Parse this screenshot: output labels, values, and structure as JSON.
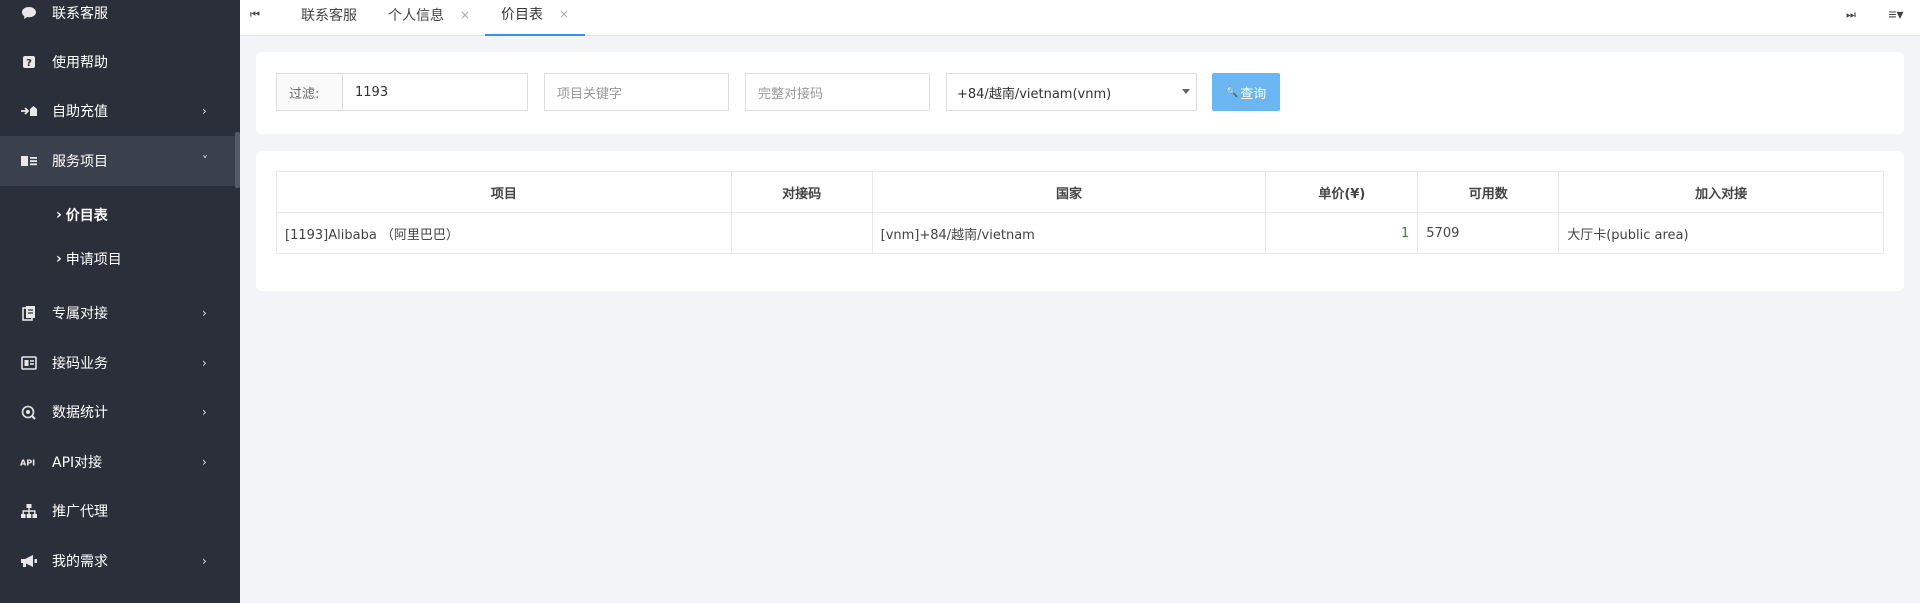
{
  "sidebar": {
    "items": [
      {
        "label": "联系客服",
        "icon": "chat-icon",
        "arrow": ""
      },
      {
        "label": "使用帮助",
        "icon": "help-icon",
        "arrow": ""
      },
      {
        "label": "自助充值",
        "icon": "recharge-icon",
        "arrow": "›"
      },
      {
        "label": "服务项目",
        "icon": "service-icon",
        "arrow": "˅"
      },
      {
        "label": "专属对接",
        "icon": "docs-icon",
        "arrow": "›"
      },
      {
        "label": "接码业务",
        "icon": "sim-icon",
        "arrow": "›"
      },
      {
        "label": "数据统计",
        "icon": "stats-icon",
        "arrow": "›"
      },
      {
        "label": "API对接",
        "icon": "api-icon",
        "arrow": "›"
      },
      {
        "label": "推广代理",
        "icon": "sitemap-icon",
        "arrow": ""
      },
      {
        "label": "我的需求",
        "icon": "megaphone-icon",
        "arrow": "›"
      }
    ],
    "subitems": [
      {
        "label": "价目表",
        "caret": "›"
      },
      {
        "label": "申请项目",
        "caret": "›"
      }
    ]
  },
  "tabbar": {
    "prev_icon": "⏮",
    "next_icon": "⏭",
    "menu_icon": "≡▾",
    "tabs": [
      {
        "label": "联系客服",
        "close": ""
      },
      {
        "label": "个人信息",
        "close": "×"
      },
      {
        "label": "价目表",
        "close": "×"
      }
    ]
  },
  "filter": {
    "label": "过滤:",
    "project_id_value": "1193",
    "keyword_placeholder": "项目关键字",
    "code_placeholder": "完整对接码",
    "country_selected": "+84/越南/vietnam(vnm)",
    "query_label": "查询",
    "query_icon": "🔍"
  },
  "table": {
    "headers": [
      "项目",
      "对接码",
      "国家",
      "单价(¥)",
      "可用数",
      "加入对接"
    ],
    "rows": [
      {
        "project": "[1193]Alibaba （阿里巴巴）",
        "code": "",
        "country": "[vnm]+84/越南/vietnam",
        "price": "1",
        "available": "5709",
        "join": "大厅卡(public area)"
      }
    ]
  },
  "colors": {
    "sidebar_bg": "#2a2f3a",
    "accent": "#3e8ef7",
    "button": "#6ab7f3",
    "price_text": "#2f8f2f"
  }
}
